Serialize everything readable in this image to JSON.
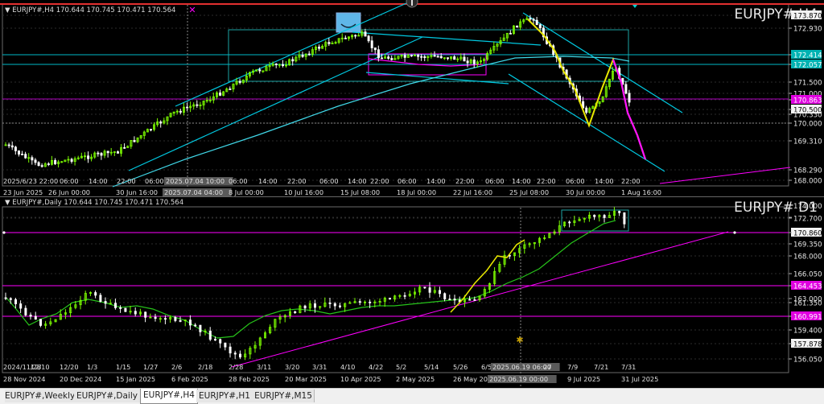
{
  "colors": {
    "bg": "#000000",
    "bull": "#7cfc00",
    "bear": "#ffffff",
    "cyan": "#00ced1",
    "magenta": "#ff00ff",
    "yellow": "#ffff00",
    "green": "#32cd32",
    "label_bg_cyan": "#00b3b3",
    "label_bg_magenta": "#e000e0",
    "label_bg_white": "#f2f2f2"
  },
  "h4": {
    "info": "▼ EURJPY#,H4 170.644 170.745 170.471 170.564",
    "watermark": "EURJPY# H4",
    "price_labels": [
      {
        "text": "173.870",
        "style": "white"
      },
      {
        "text": "172.930",
        "style": "plain"
      },
      {
        "text": "172.414",
        "style": "cyan"
      },
      {
        "text": "172.057",
        "style": "cyan"
      },
      {
        "text": "171.500",
        "style": "plain"
      },
      {
        "text": "171.000",
        "style": "plain"
      },
      {
        "text": "170.863",
        "style": "magenta"
      },
      {
        "text": "170.500",
        "style": "white"
      },
      {
        "text": "170.330",
        "style": "plain"
      },
      {
        "text": "170.000",
        "style": "plain"
      },
      {
        "text": "169.310",
        "style": "plain"
      },
      {
        "text": "168.290",
        "style": "plain"
      },
      {
        "text": "168.000",
        "style": "plain"
      }
    ],
    "time_labels": [
      {
        "text": "23 Jun 2025"
      },
      {
        "text": "26 Jun 00:00"
      },
      {
        "text": "30 Jun 16:00"
      },
      {
        "text": "2025.07.04 04:00",
        "style": "highlight"
      },
      {
        "text": "8 Jul 00:00"
      },
      {
        "text": "10 Jul 16:00"
      },
      {
        "text": "15 Jul 08:00"
      },
      {
        "text": "18 Jul 00:00"
      },
      {
        "text": "22 Jul 16:00"
      },
      {
        "text": "25 Jul 08:00"
      },
      {
        "text": "30 Jul 00:00"
      },
      {
        "text": "1 Aug 16:00"
      }
    ],
    "hour_labels": [
      {
        "text": "2025/6/23 22:00"
      },
      {
        "text": "06:00"
      },
      {
        "text": "14:00"
      },
      {
        "text": "22:00"
      },
      {
        "text": "06:00"
      },
      {
        "text": "2025.07.04 10:00",
        "style": "highlight"
      },
      {
        "text": "06:00"
      },
      {
        "text": "14:00"
      },
      {
        "text": "22:00"
      },
      {
        "text": "06:00"
      },
      {
        "text": "14:00"
      },
      {
        "text": "22:00"
      },
      {
        "text": "06:00"
      },
      {
        "text": "14:00"
      },
      {
        "text": "22:00"
      },
      {
        "text": "06:00"
      },
      {
        "text": "14:00"
      },
      {
        "text": "22:00"
      },
      {
        "text": "06:00"
      },
      {
        "text": "14:00"
      },
      {
        "text": "22:00"
      }
    ]
  },
  "d1": {
    "info": "▼ EURJPY#,Daily 170.644 170.745 170.471 170.564",
    "watermark": "EURJPY# D1",
    "price_labels": [
      {
        "text": "174.000",
        "style": "plain"
      },
      {
        "text": "172.700",
        "style": "plain"
      },
      {
        "text": "170.860",
        "style": "white"
      },
      {
        "text": "169.350",
        "style": "plain"
      },
      {
        "text": "168.000",
        "style": "plain"
      },
      {
        "text": "166.050",
        "style": "plain"
      },
      {
        "text": "164.453",
        "style": "magenta"
      },
      {
        "text": "163.000",
        "style": "plain"
      },
      {
        "text": "161.350",
        "style": "plain"
      },
      {
        "text": "160.991",
        "style": "magenta"
      },
      {
        "text": "159.400",
        "style": "plain"
      },
      {
        "text": "157.878",
        "style": "white"
      },
      {
        "text": "156.050",
        "style": "plain"
      }
    ],
    "time_labels": [
      {
        "text": "28 Nov 2024"
      },
      {
        "text": "20 Dec 2024"
      },
      {
        "text": "15 Jan 2025"
      },
      {
        "text": "6 Feb 2025"
      },
      {
        "text": "28 Feb 2025"
      },
      {
        "text": "20 Mar 2025"
      },
      {
        "text": "10 Apr 2025"
      },
      {
        "text": "2 May 2025"
      },
      {
        "text": "26 May 2025"
      },
      {
        "text": "2025.06.19 00:00",
        "style": "highlight"
      },
      {
        "text": "9 Jul 2025"
      },
      {
        "text": "31 Jul 2025"
      }
    ],
    "date_labels": [
      {
        "text": "2024/11/28"
      },
      {
        "text": "12/10"
      },
      {
        "text": "12/20"
      },
      {
        "text": "1/3"
      },
      {
        "text": "1/15"
      },
      {
        "text": "1/27"
      },
      {
        "text": "2/6"
      },
      {
        "text": "2/18"
      },
      {
        "text": "2/28"
      },
      {
        "text": "3/11"
      },
      {
        "text": "3/20"
      },
      {
        "text": "3/31"
      },
      {
        "text": "4/10"
      },
      {
        "text": "4/22"
      },
      {
        "text": "5/2"
      },
      {
        "text": "5/14"
      },
      {
        "text": "5/26"
      },
      {
        "text": "6/5"
      },
      {
        "text": "2025.06.19 06:00",
        "style": "highlight"
      },
      {
        "text": "27"
      },
      {
        "text": "7/9"
      },
      {
        "text": "7/21"
      },
      {
        "text": "7/31"
      }
    ]
  },
  "tabs": [
    {
      "label": "EURJPY#,Weekly",
      "active": false
    },
    {
      "label": "EURJPY#,Daily",
      "active": false
    },
    {
      "label": "EURJPY#,H4",
      "active": true
    },
    {
      "label": "EURJPY#,H1",
      "active": false
    },
    {
      "label": "EURJPY#,M15",
      "active": false
    }
  ]
}
